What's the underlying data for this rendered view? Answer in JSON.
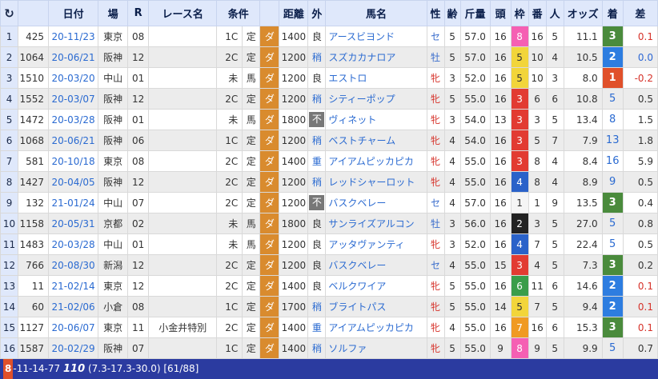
{
  "colors": {
    "header_bg": "#dfe8fb",
    "link_blue": "#2a6ad1",
    "dirt_orange": "#d98b2e",
    "footer_bg": "#2b3ba0"
  },
  "waku_colors": {
    "1": "#f5f5f5",
    "2": "#222222",
    "3": "#e23b32",
    "4": "#2a62c9",
    "5": "#f2d53a",
    "6": "#3a9d4a",
    "7": "#f09a22",
    "8": "#f55fb3"
  },
  "header": {
    "reload_icon": "reload-icon",
    "cols": [
      "日付",
      "場",
      "R",
      "レース名",
      "条件",
      "距離",
      "外",
      "馬名",
      "性",
      "齢",
      "斤量",
      "頭",
      "枠",
      "番",
      "人",
      "オッズ",
      "着",
      "差"
    ]
  },
  "rows": [
    {
      "no": "1",
      "id": "425",
      "date": "20-11/23",
      "venue": "東京",
      "r": "08",
      "race": "",
      "cls": "1C",
      "cond": "定",
      "surf": "ダ",
      "dist": "1400",
      "track": "良",
      "horse": "アースビヨンド",
      "sex": "セ",
      "age": "5",
      "kin": "57.0",
      "heads": "16",
      "waku": "8",
      "ban": "16",
      "pop": "5",
      "odds": "11.1",
      "fin": "3",
      "diff": "0.1"
    },
    {
      "no": "2",
      "id": "1064",
      "date": "20-06/21",
      "venue": "阪神",
      "r": "12",
      "race": "",
      "cls": "2C",
      "cond": "定",
      "surf": "ダ",
      "dist": "1200",
      "track": "稍",
      "horse": "スズカカナロア",
      "sex": "牡",
      "age": "5",
      "kin": "57.0",
      "heads": "16",
      "waku": "5",
      "ban": "10",
      "pop": "4",
      "odds": "10.5",
      "fin": "2",
      "diff": "0.0"
    },
    {
      "no": "3",
      "id": "1510",
      "date": "20-03/20",
      "venue": "中山",
      "r": "01",
      "race": "",
      "cls": "未",
      "cond": "馬",
      "surf": "ダ",
      "dist": "1200",
      "track": "良",
      "horse": "エストロ",
      "sex": "牝",
      "age": "3",
      "kin": "52.0",
      "heads": "16",
      "waku": "5",
      "ban": "10",
      "pop": "3",
      "odds": "8.0",
      "fin": "1",
      "diff": "-0.2"
    },
    {
      "no": "4",
      "id": "1552",
      "date": "20-03/07",
      "venue": "阪神",
      "r": "12",
      "race": "",
      "cls": "2C",
      "cond": "定",
      "surf": "ダ",
      "dist": "1200",
      "track": "稍",
      "horse": "シティーポップ",
      "sex": "牝",
      "age": "5",
      "kin": "55.0",
      "heads": "16",
      "waku": "3",
      "ban": "6",
      "pop": "6",
      "odds": "10.8",
      "fin": "5",
      "diff": "0.5"
    },
    {
      "no": "5",
      "id": "1472",
      "date": "20-03/28",
      "venue": "阪神",
      "r": "01",
      "race": "",
      "cls": "未",
      "cond": "馬",
      "surf": "ダ",
      "dist": "1800",
      "track": "不",
      "horse": "ヴィネット",
      "sex": "牝",
      "age": "3",
      "kin": "54.0",
      "heads": "13",
      "waku": "3",
      "ban": "3",
      "pop": "5",
      "odds": "13.4",
      "fin": "8",
      "diff": "1.5"
    },
    {
      "no": "6",
      "id": "1068",
      "date": "20-06/21",
      "venue": "阪神",
      "r": "06",
      "race": "",
      "cls": "1C",
      "cond": "定",
      "surf": "ダ",
      "dist": "1200",
      "track": "稍",
      "horse": "ベストチャーム",
      "sex": "牝",
      "age": "4",
      "kin": "54.0",
      "heads": "16",
      "waku": "3",
      "ban": "5",
      "pop": "7",
      "odds": "7.9",
      "fin": "13",
      "diff": "1.8"
    },
    {
      "no": "7",
      "id": "581",
      "date": "20-10/18",
      "venue": "東京",
      "r": "08",
      "race": "",
      "cls": "2C",
      "cond": "定",
      "surf": "ダ",
      "dist": "1400",
      "track": "重",
      "horse": "アイアムピッカピカ",
      "sex": "牝",
      "age": "4",
      "kin": "55.0",
      "heads": "16",
      "waku": "3",
      "ban": "8",
      "pop": "4",
      "odds": "8.4",
      "fin": "16",
      "diff": "5.9"
    },
    {
      "no": "8",
      "id": "1427",
      "date": "20-04/05",
      "venue": "阪神",
      "r": "12",
      "race": "",
      "cls": "2C",
      "cond": "定",
      "surf": "ダ",
      "dist": "1200",
      "track": "稍",
      "horse": "レッドシャーロット",
      "sex": "牝",
      "age": "4",
      "kin": "55.0",
      "heads": "16",
      "waku": "4",
      "ban": "8",
      "pop": "4",
      "odds": "8.9",
      "fin": "9",
      "diff": "0.5"
    },
    {
      "no": "9",
      "id": "132",
      "date": "21-01/24",
      "venue": "中山",
      "r": "07",
      "race": "",
      "cls": "2C",
      "cond": "定",
      "surf": "ダ",
      "dist": "1200",
      "track": "不",
      "horse": "バスクベレー",
      "sex": "セ",
      "age": "4",
      "kin": "57.0",
      "heads": "16",
      "waku": "1",
      "ban": "1",
      "pop": "9",
      "odds": "13.5",
      "fin": "3",
      "diff": "0.4"
    },
    {
      "no": "10",
      "id": "1158",
      "date": "20-05/31",
      "venue": "京都",
      "r": "02",
      "race": "",
      "cls": "未",
      "cond": "馬",
      "surf": "ダ",
      "dist": "1800",
      "track": "良",
      "horse": "サンライズアルコン",
      "sex": "牡",
      "age": "3",
      "kin": "56.0",
      "heads": "16",
      "waku": "2",
      "ban": "3",
      "pop": "5",
      "odds": "27.0",
      "fin": "5",
      "diff": "0.8"
    },
    {
      "no": "11",
      "id": "1483",
      "date": "20-03/28",
      "venue": "中山",
      "r": "01",
      "race": "",
      "cls": "未",
      "cond": "馬",
      "surf": "ダ",
      "dist": "1200",
      "track": "良",
      "horse": "アッタヴァンティ",
      "sex": "牝",
      "age": "3",
      "kin": "52.0",
      "heads": "16",
      "waku": "4",
      "ban": "7",
      "pop": "5",
      "odds": "22.4",
      "fin": "5",
      "diff": "0.5"
    },
    {
      "no": "12",
      "id": "766",
      "date": "20-08/30",
      "venue": "新潟",
      "r": "12",
      "race": "",
      "cls": "2C",
      "cond": "定",
      "surf": "ダ",
      "dist": "1200",
      "track": "良",
      "horse": "バスクベレー",
      "sex": "セ",
      "age": "4",
      "kin": "55.0",
      "heads": "15",
      "waku": "3",
      "ban": "4",
      "pop": "5",
      "odds": "7.3",
      "fin": "3",
      "diff": "0.2"
    },
    {
      "no": "13",
      "id": "11",
      "date": "21-02/14",
      "venue": "東京",
      "r": "12",
      "race": "",
      "cls": "2C",
      "cond": "定",
      "surf": "ダ",
      "dist": "1400",
      "track": "良",
      "horse": "ベルクワイア",
      "sex": "牝",
      "age": "5",
      "kin": "55.0",
      "heads": "16",
      "waku": "6",
      "ban": "11",
      "pop": "6",
      "odds": "14.6",
      "fin": "2",
      "diff": "0.1"
    },
    {
      "no": "14",
      "id": "60",
      "date": "21-02/06",
      "venue": "小倉",
      "r": "08",
      "race": "",
      "cls": "1C",
      "cond": "定",
      "surf": "ダ",
      "dist": "1700",
      "track": "稍",
      "horse": "ブライトパス",
      "sex": "牝",
      "age": "5",
      "kin": "55.0",
      "heads": "14",
      "waku": "5",
      "ban": "7",
      "pop": "5",
      "odds": "9.4",
      "fin": "2",
      "diff": "0.1"
    },
    {
      "no": "15",
      "id": "1127",
      "date": "20-06/07",
      "venue": "東京",
      "r": "11",
      "race": "小金井特別",
      "cls": "2C",
      "cond": "定",
      "surf": "ダ",
      "dist": "1400",
      "track": "重",
      "horse": "アイアムピッカピカ",
      "sex": "牝",
      "age": "4",
      "kin": "55.0",
      "heads": "16",
      "waku": "7",
      "ban": "16",
      "pop": "6",
      "odds": "15.3",
      "fin": "3",
      "diff": "0.1"
    },
    {
      "no": "16",
      "id": "1587",
      "date": "20-02/29",
      "venue": "阪神",
      "r": "07",
      "race": "",
      "cls": "1C",
      "cond": "定",
      "surf": "ダ",
      "dist": "1400",
      "track": "稍",
      "horse": "ソルファ",
      "sex": "牝",
      "age": "5",
      "kin": "55.0",
      "heads": "9",
      "waku": "8",
      "ban": "9",
      "pop": "5",
      "odds": "9.9",
      "fin": "5",
      "diff": "0.7"
    }
  ],
  "footer": {
    "lead": "8",
    "combo": "-11-14-77",
    "score": "110",
    "rest": "(7.3-17.3-30.0) [61/88]"
  }
}
